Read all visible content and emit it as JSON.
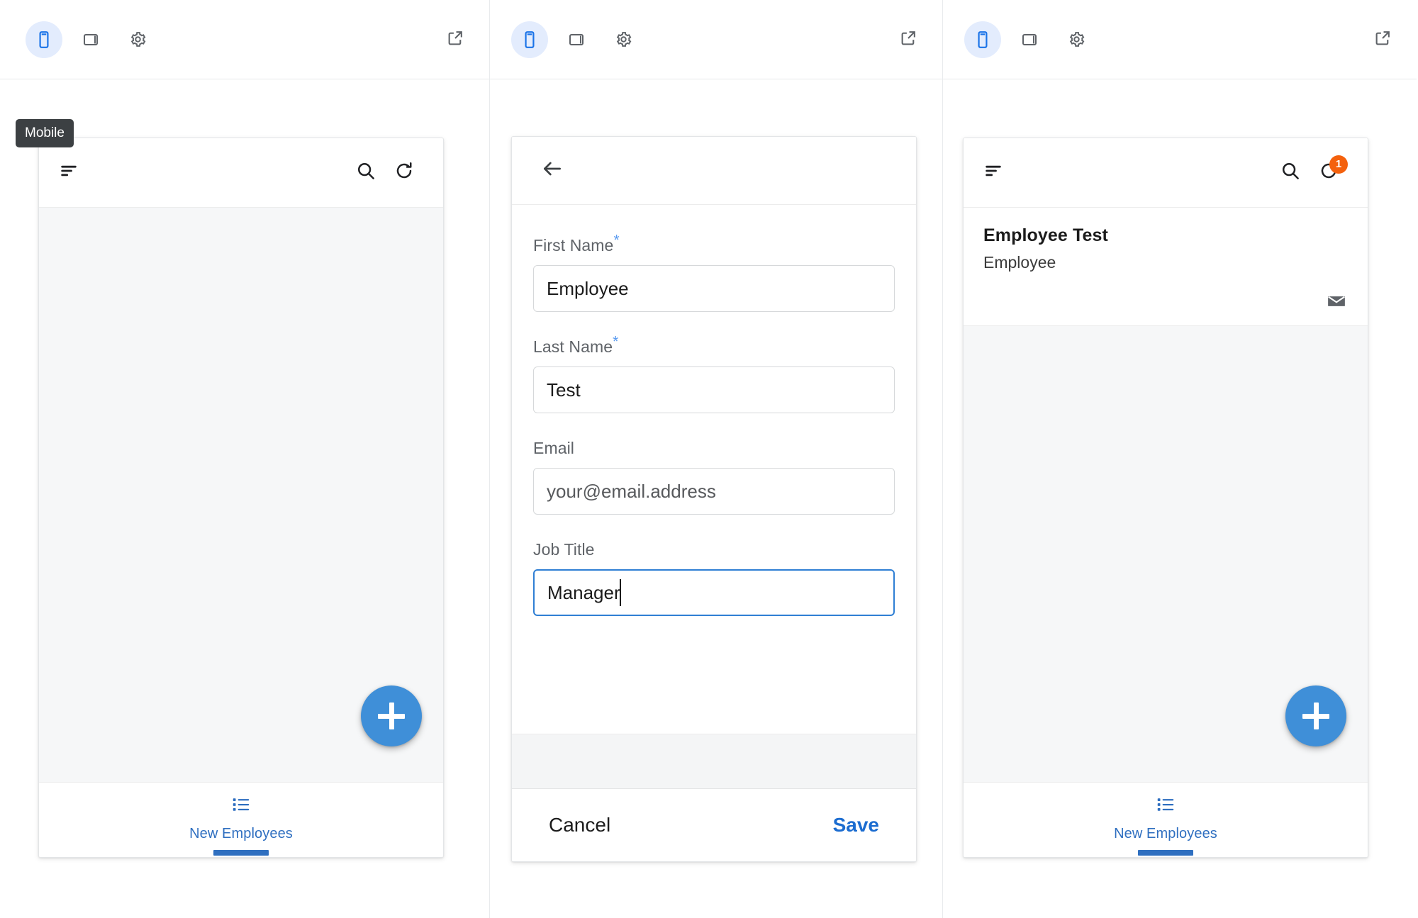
{
  "colors": {
    "accent_blue": "#3f8fd8",
    "link_blue": "#1b6cd0",
    "nav_blue": "#2f6fc0",
    "badge_orange": "#f4610d",
    "required_star": "#5a9bf0",
    "tooltip_bg": "#3c4043",
    "body_bg": "#f6f7f8"
  },
  "device_toolbar": {
    "buttons": [
      {
        "name": "mobile-view",
        "icon": "mobile-icon",
        "active": true
      },
      {
        "name": "tablet-view",
        "icon": "tablet-icon",
        "active": false
      },
      {
        "name": "settings",
        "icon": "gear-icon",
        "active": false
      }
    ],
    "open_external": {
      "name": "open-in-new",
      "icon": "external-link-icon"
    }
  },
  "tooltip": {
    "text": "Mobile"
  },
  "panel1": {
    "appbar": {
      "sort_icon": "sort-icon",
      "search_icon": "search-icon",
      "refresh_icon": "refresh-icon"
    },
    "fab": {
      "icon": "plus-icon",
      "label": "+"
    },
    "bottom_nav": {
      "icon": "list-icon",
      "label": "New Employees"
    }
  },
  "panel2": {
    "back_icon": "back-arrow-icon",
    "form": {
      "fields": [
        {
          "label": "First Name",
          "required": true,
          "value": "Employee",
          "placeholder": "",
          "focused": false,
          "is_placeholder": false
        },
        {
          "label": "Last Name",
          "required": true,
          "value": "Test",
          "placeholder": "",
          "focused": false,
          "is_placeholder": false
        },
        {
          "label": "Email",
          "required": false,
          "value": "your@email.address",
          "placeholder": "your@email.address",
          "focused": false,
          "is_placeholder": true
        },
        {
          "label": "Job Title",
          "required": false,
          "value": "Manager",
          "placeholder": "",
          "focused": true,
          "is_placeholder": false
        }
      ]
    },
    "footer": {
      "cancel_label": "Cancel",
      "save_label": "Save"
    }
  },
  "panel3": {
    "appbar": {
      "sort_icon": "sort-icon",
      "search_icon": "search-icon",
      "refresh_icon": "refresh-icon",
      "refresh_badge": "1"
    },
    "list": [
      {
        "title": "Employee Test",
        "subtitle": "Employee",
        "action_icon": "email-icon"
      }
    ],
    "fab": {
      "icon": "plus-icon",
      "label": "+"
    },
    "bottom_nav": {
      "icon": "list-icon",
      "label": "New Employees"
    }
  }
}
